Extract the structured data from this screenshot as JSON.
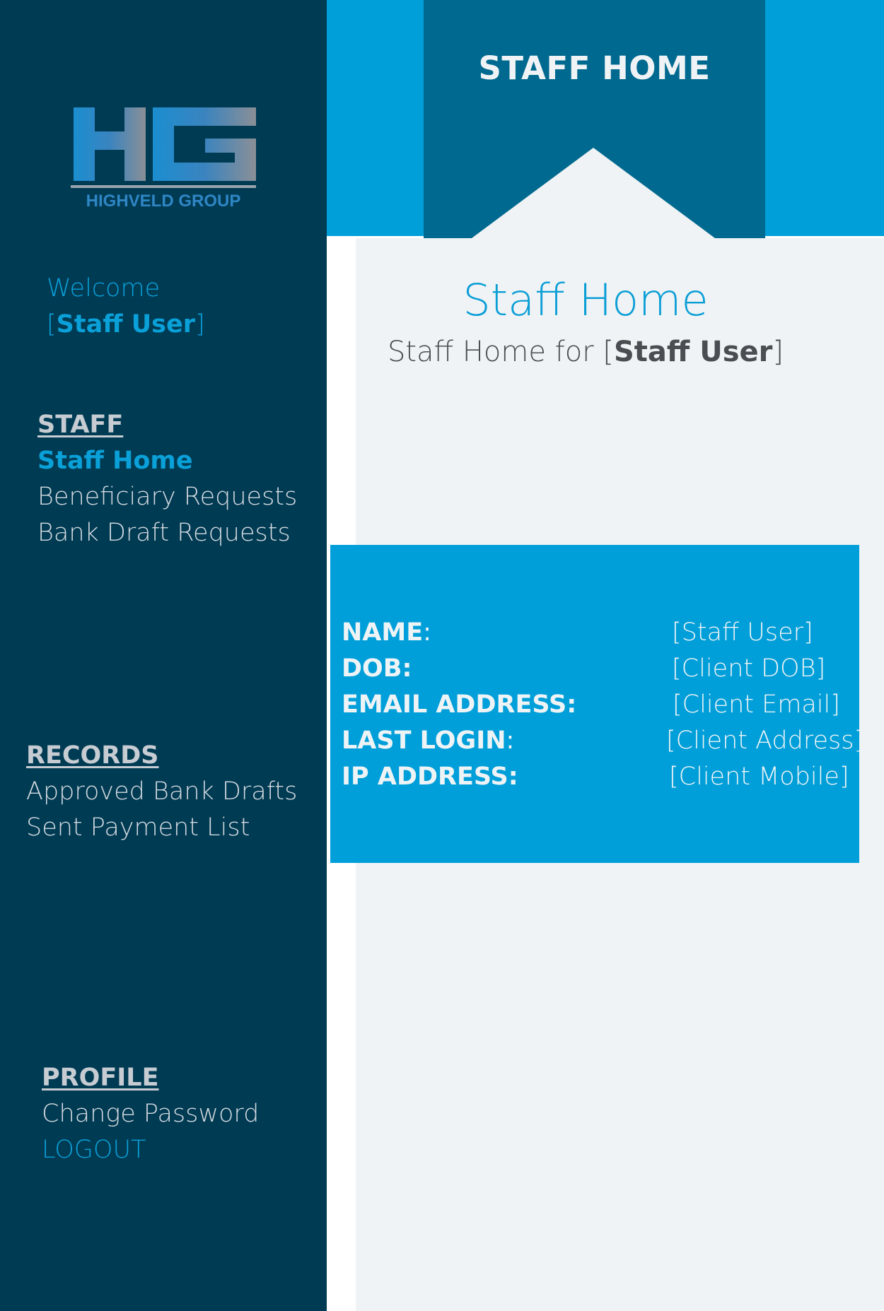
{
  "brand": {
    "logo_monogram": "HG",
    "logo_text": "HIGHVELD GROUP"
  },
  "header": {
    "title": "STAFF HOME"
  },
  "sidebar": {
    "welcome_text": "Welcome",
    "user_name": "Staff User",
    "sections": {
      "staff": {
        "heading": "STAFF",
        "items": [
          "Staff Home",
          "Beneficiary Requests",
          "Bank Draft Requests"
        ]
      },
      "records": {
        "heading": "RECORDS",
        "items": [
          "Approved Bank Drafts",
          "Sent Payment List"
        ]
      },
      "profile": {
        "heading": "PROFILE",
        "items": [
          "Change Password",
          "LOGOUT"
        ]
      }
    }
  },
  "main": {
    "title": "Staff Home",
    "subtitle_prefix": "Staff Home for",
    "subtitle_user": "Staff User",
    "info": [
      {
        "label": "NAME",
        "suffix": ":",
        "value": "[Staff User]"
      },
      {
        "label": "DOB:",
        "suffix": "",
        "value": "[Client DOB]"
      },
      {
        "label": "EMAIL ADDRESS:",
        "suffix": "",
        "value": "[Client Email]"
      },
      {
        "label": "LAST LOGIN",
        "suffix": ":",
        "value": "[Client Address]"
      },
      {
        "label": "IP ADDRESS:",
        "suffix": "",
        "value": "[Client Mobile]"
      }
    ]
  },
  "colors": {
    "sidebar_bg": "#003b54",
    "accent": "#0aa0d8",
    "header_band": "#009fd9",
    "header_tab": "#00698f",
    "content_bg": "#eff3f5",
    "info_card": "#009fd9"
  }
}
